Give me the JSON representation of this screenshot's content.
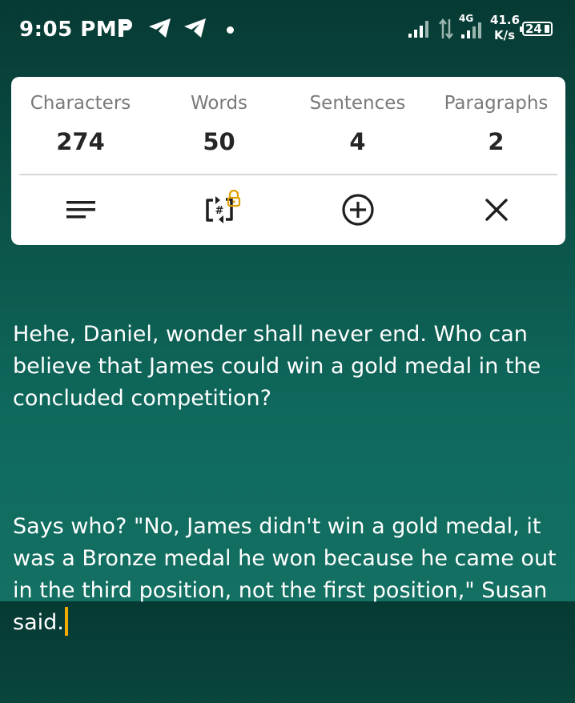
{
  "status_bar": {
    "time": "9:05 PM",
    "network_type": "4G",
    "net_speed_value": "41.6",
    "net_speed_unit": "K/s",
    "battery_level": "24",
    "icons": [
      "p-app-icon",
      "telegram-icon",
      "telegram-icon",
      "notification-dot",
      "signal-icon",
      "data-arrows-icon",
      "signal-4g-icon",
      "battery-icon"
    ]
  },
  "stats": {
    "characters_label": "Characters",
    "characters_value": "274",
    "words_label": "Words",
    "words_value": "50",
    "sentences_label": "Sentences",
    "sentences_value": "4",
    "paragraphs_label": "Paragraphs",
    "paragraphs_value": "2"
  },
  "actions": [
    {
      "icon": "menu-lines-icon"
    },
    {
      "icon": "hashtag-swap-icon",
      "badge": "lock-icon"
    },
    {
      "icon": "add-circle-icon"
    },
    {
      "icon": "close-icon"
    }
  ],
  "editor": {
    "paragraph_1": "Hehe, Daniel, wonder shall never end. Who can believe that James could win a gold medal in the concluded competition?",
    "paragraph_2": "Says who? \"No, James didn't win a gold medal, it was a Bronze medal he won because he came out in the third position, not the first position,\" Susan said."
  },
  "colors": {
    "background_top": "#063a33",
    "background_bottom": "#137062",
    "card": "#ffffff",
    "caret": "#f2a900",
    "lock": "#e0a100"
  }
}
